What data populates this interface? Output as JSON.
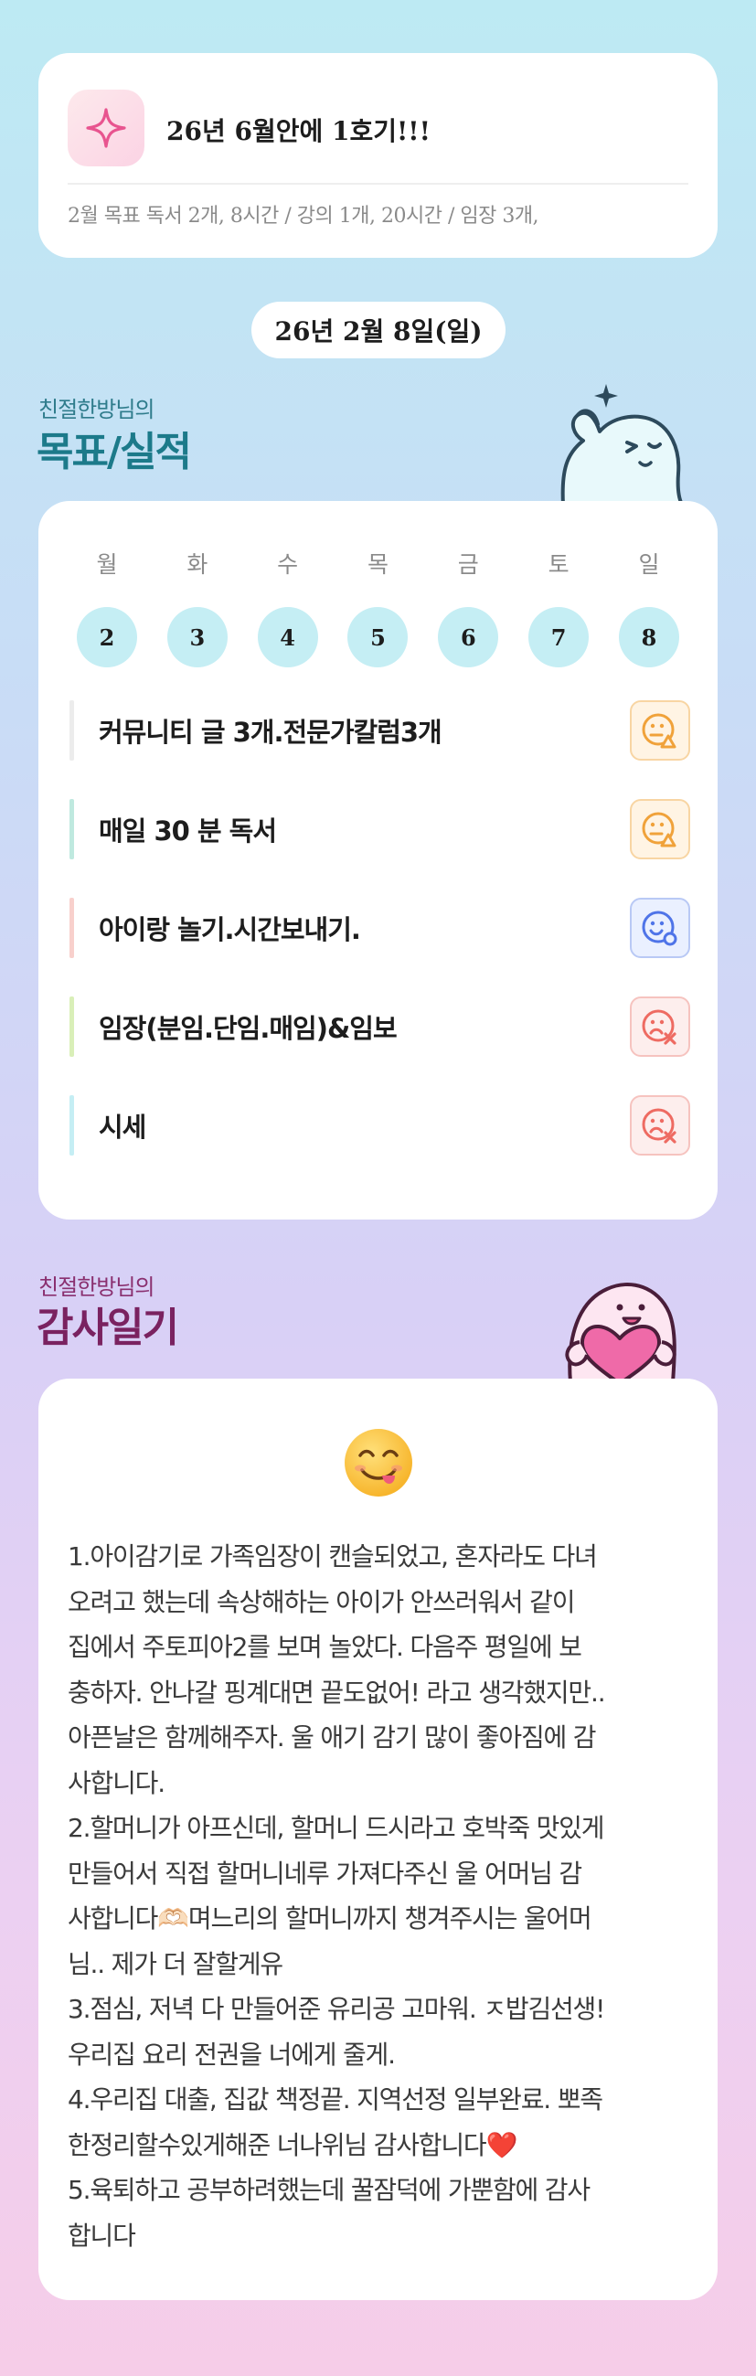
{
  "goal_banner": {
    "icon": "sparkle-icon",
    "title": "26년 6월안에 1호기!!!",
    "subtitle": "2월 목표  독서 2개, 8시간 / 강의 1개, 20시간 / 임장 3개,"
  },
  "date_label": "26년 2월 8일(일)",
  "goals_section": {
    "subtitle": "친절한방님의",
    "title": "목표/실적",
    "days": [
      {
        "name": "월",
        "num": "2"
      },
      {
        "name": "화",
        "num": "3"
      },
      {
        "name": "수",
        "num": "4"
      },
      {
        "name": "목",
        "num": "5"
      },
      {
        "name": "금",
        "num": "6"
      },
      {
        "name": "토",
        "num": "7"
      },
      {
        "name": "일",
        "num": "8"
      }
    ],
    "tasks": [
      {
        "label": "커뮤니티 글 3개.전문가칼럼3개",
        "bar_color": "#ececec",
        "status": "partial",
        "status_icon": "partial-face-icon",
        "color": "#f0a23a"
      },
      {
        "label": "매일 30 분 독서",
        "bar_color": "#bfe9df",
        "status": "partial",
        "status_icon": "partial-face-icon",
        "color": "#f0a23a"
      },
      {
        "label": "아이랑 놀기.시간보내기.",
        "bar_color": "#f8d0cc",
        "status": "done",
        "status_icon": "done-face-icon",
        "color": "#4f74e8"
      },
      {
        "label": "임장(분임.단임.매임)&임보",
        "bar_color": "#d9efb8",
        "status": "fail",
        "status_icon": "fail-face-icon",
        "color": "#ee6b62"
      },
      {
        "label": "시세",
        "bar_color": "#c5eef4",
        "status": "fail",
        "status_icon": "fail-face-icon",
        "color": "#ee6b62"
      }
    ]
  },
  "diary_section": {
    "subtitle": "친절한방님의",
    "title": "감사일기",
    "emoji": "yum-face-emoji",
    "text": "1.아이감기로 가족임장이 캔슬되었고, 혼자라도 다녀\n오려고 했는데 속상해하는 아이가 안쓰러워서 같이\n집에서 주토피아2를 보며 놀았다. 다음주 평일에 보\n충하자. 안나갈 핑계대면 끝도없어! 라고 생각했지만..\n아픈날은 함께해주자. 울 애기 감기 많이 좋아짐에 감\n사합니다.\n2.할머니가 아프신데, 할머니 드시라고 호박죽 맛있게\n만들어서  직접 할머니네루 가져다주신 울 어머님 감\n사합니다🫶🏻며느리의 할머니까지 챙겨주시는 울어머\n님.. 제가 더 잘할게유\n3.점심, 저녁 다 만들어준 유리공 고마워. ㅈ밥김선생!\n우리집 요리 전권을 너에게 줄게.\n4.우리집 대출, 집값 책정끝. 지역선정 일부완료. 뽀족\n한정리할수있게해준 너나위님 감사합니다❤️\n5.육퇴하고 공부하려했는데 꿀잠덕에 가뿐함에 감사\n합니다"
  }
}
